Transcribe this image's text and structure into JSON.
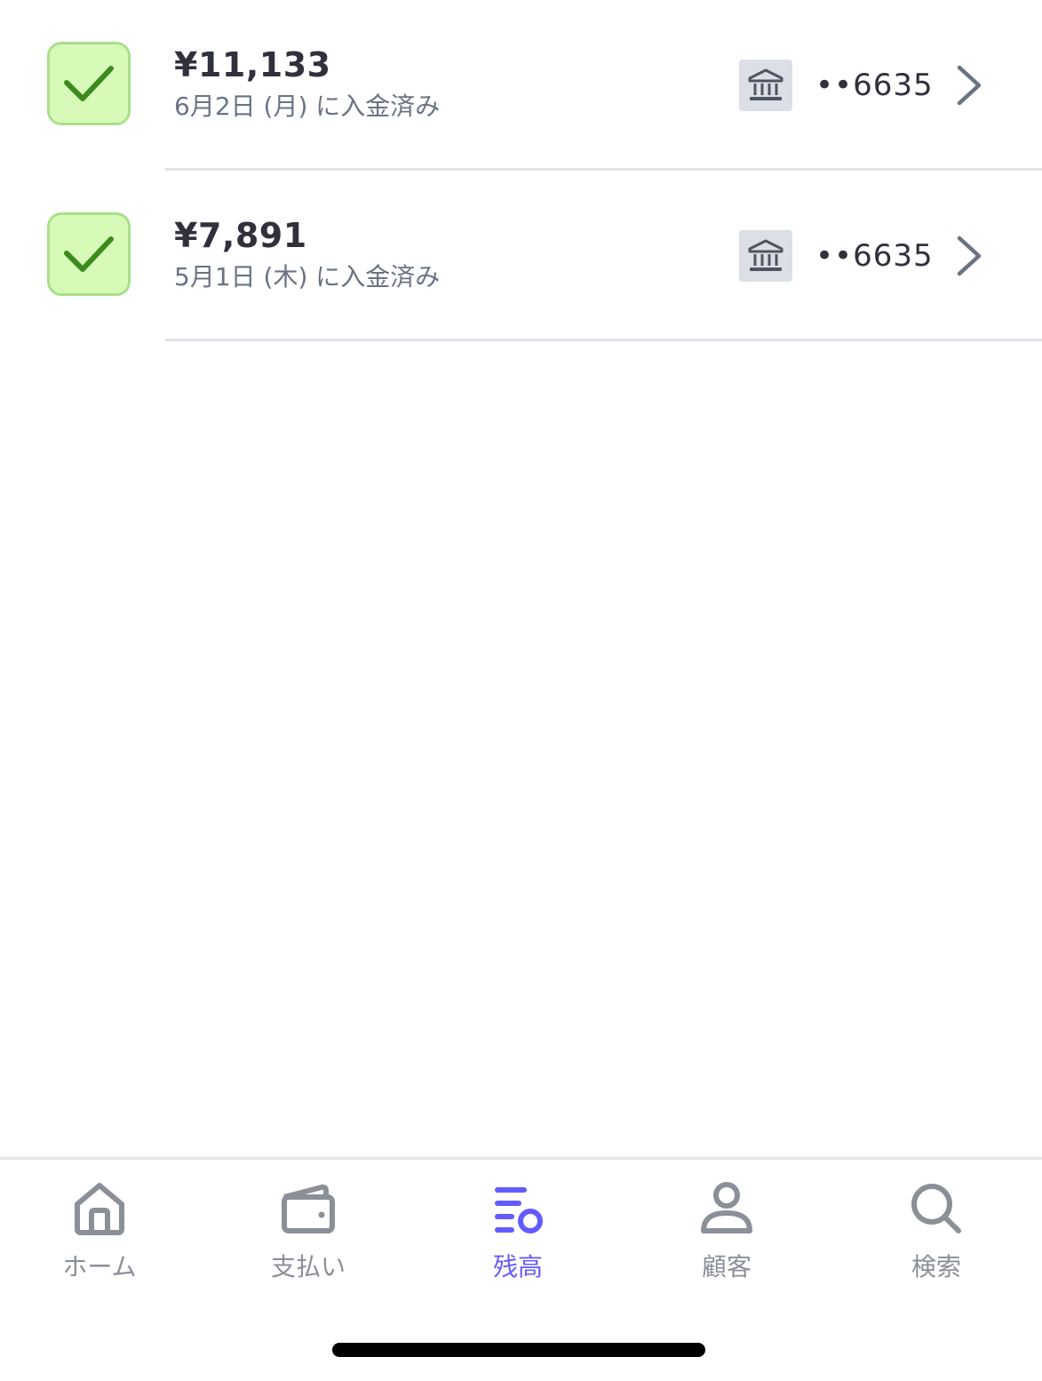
{
  "payouts": [
    {
      "amount": "¥11,133",
      "status_text": "6月2日 (月) に入金済み",
      "account": "••6635",
      "status_icon": "check-icon",
      "destination_icon": "bank-icon"
    },
    {
      "amount": "¥7,891",
      "status_text": "5月1日 (木) に入金済み",
      "account": "••6635",
      "status_icon": "check-icon",
      "destination_icon": "bank-icon"
    }
  ],
  "tab_bar": {
    "active_tab": "残高",
    "tabs": [
      {
        "label": "ホーム",
        "icon": "home-icon"
      },
      {
        "label": "支払い",
        "icon": "wallet-icon"
      },
      {
        "label": "残高",
        "icon": "balance-icon"
      },
      {
        "label": "顧客",
        "icon": "person-icon"
      },
      {
        "label": "検索",
        "icon": "search-icon"
      }
    ]
  },
  "colors": {
    "accent": "#635bff",
    "success_fill": "#d7fab9",
    "success_border": "#a8e08a",
    "success_check": "#3a8a1e",
    "text_primary": "#30313d",
    "text_secondary": "#6a7383",
    "tab_inactive": "#8a8f98"
  }
}
